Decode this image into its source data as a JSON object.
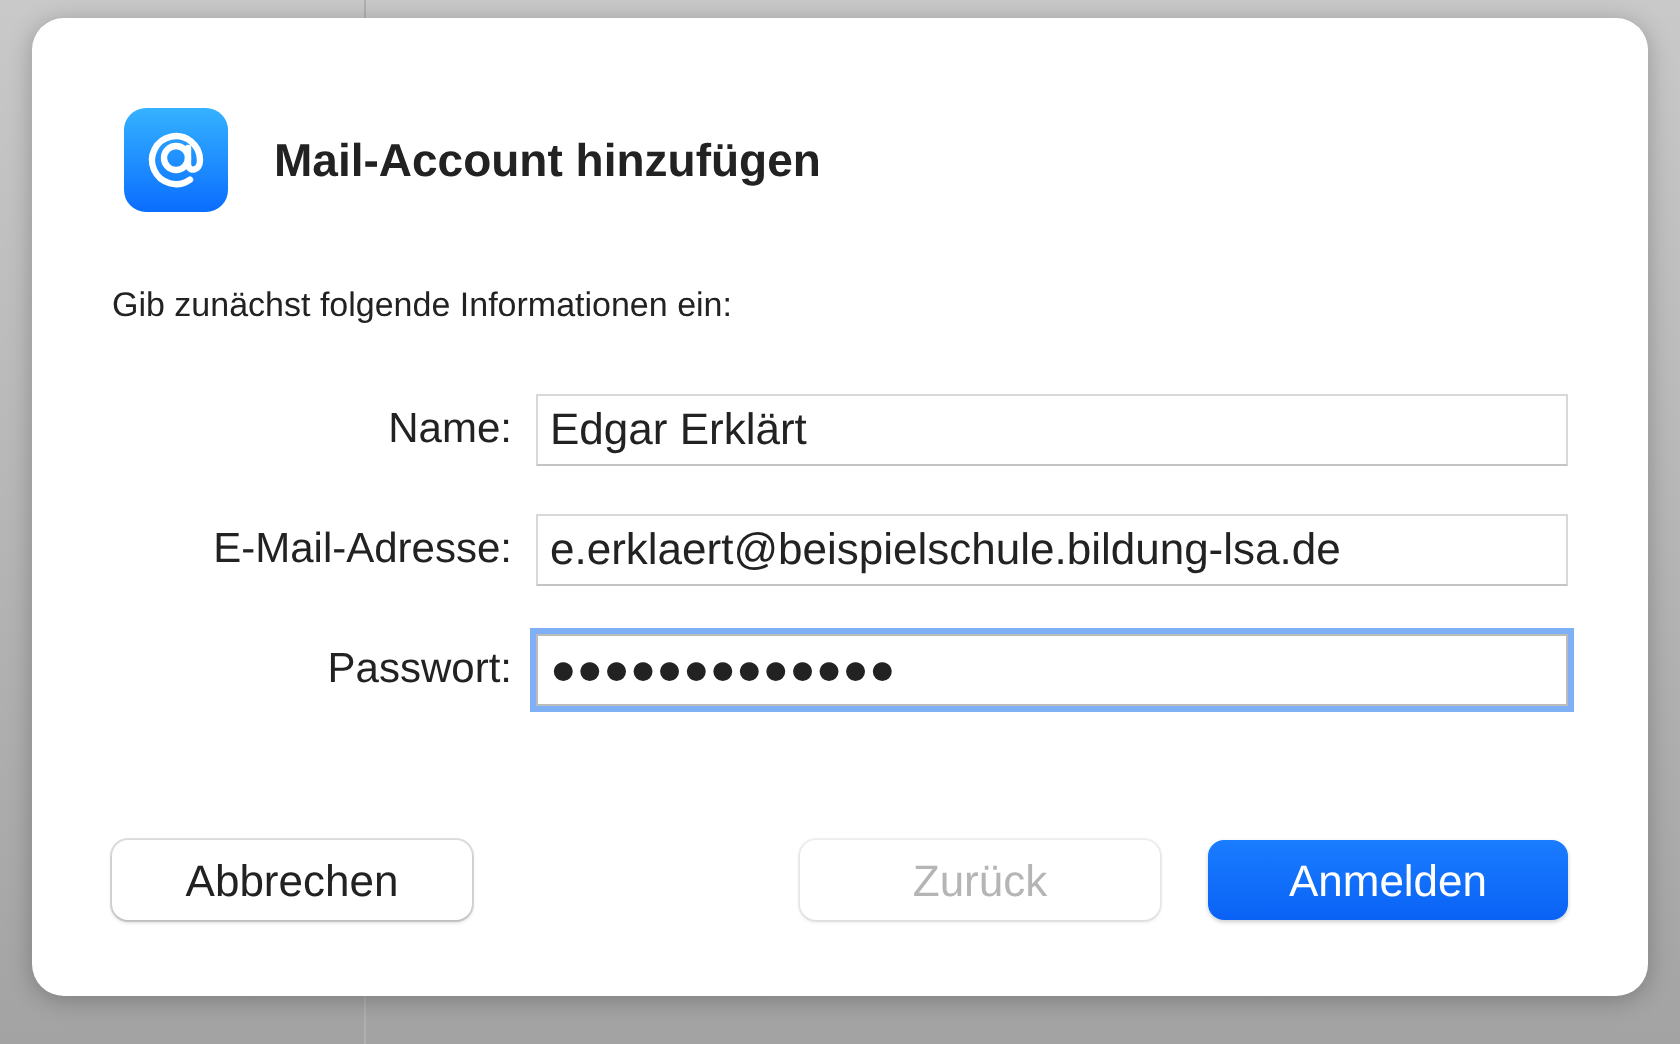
{
  "dialog": {
    "title": "Mail-Account hinzufügen",
    "prompt": "Gib zunächst folgende Informationen ein:",
    "fields": [
      {
        "label": "Name:",
        "value": "Edgar Erklärt",
        "focused": false
      },
      {
        "label": "E-Mail-Adresse:",
        "value": "e.erklaert@beispielschule.bildung-lsa.de",
        "focused": false
      },
      {
        "label": "Passwort:",
        "value": "●●●●●●●●●●●●●",
        "focused": true
      }
    ],
    "buttons": [
      {
        "label": "Abbrechen",
        "kind": "normal",
        "disabled": false
      },
      {
        "label": "Zurück",
        "kind": "normal",
        "disabled": true
      },
      {
        "label": "Anmelden",
        "kind": "primary",
        "disabled": false
      }
    ]
  }
}
